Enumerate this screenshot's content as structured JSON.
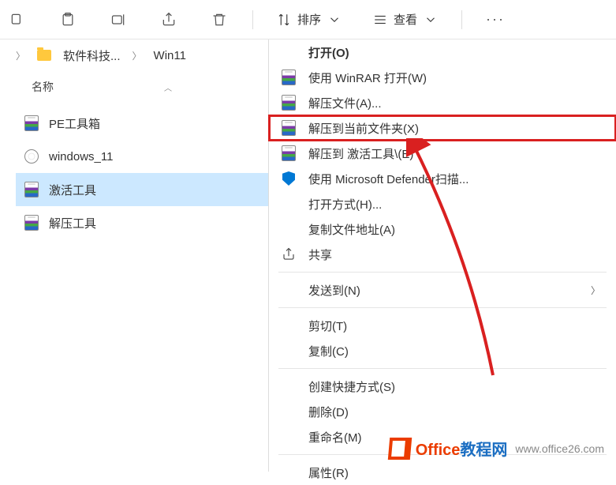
{
  "toolbar": {
    "sort_label": "排序",
    "view_label": "查看"
  },
  "breadcrumb": {
    "items": [
      "软件科技...",
      "Win11"
    ]
  },
  "columns": {
    "name": "名称"
  },
  "files": [
    {
      "name": "PE工具箱",
      "type": "rar"
    },
    {
      "name": "windows_11",
      "type": "iso"
    },
    {
      "name": "激活工具",
      "type": "rar",
      "selected": true
    },
    {
      "name": "解压工具",
      "type": "rar"
    }
  ],
  "menu": {
    "open": "打开(O)",
    "winrar_open": "使用 WinRAR 打开(W)",
    "extract_files": "解压文件(A)...",
    "extract_here": "解压到当前文件夹(X)",
    "extract_to_folder": "解压到 激活工具\\(E)",
    "defender_scan": "使用 Microsoft Defender扫描...",
    "open_with": "打开方式(H)...",
    "copy_path": "复制文件地址(A)",
    "share": "共享",
    "send_to": "发送到(N)",
    "cut": "剪切(T)",
    "copy": "复制(C)",
    "create_shortcut": "创建快捷方式(S)",
    "delete": "删除(D)",
    "rename": "重命名(M)",
    "properties": "属性(R)"
  },
  "watermark": {
    "brand1": "Office",
    "brand2": "教程网",
    "url": "www.office26.com"
  }
}
